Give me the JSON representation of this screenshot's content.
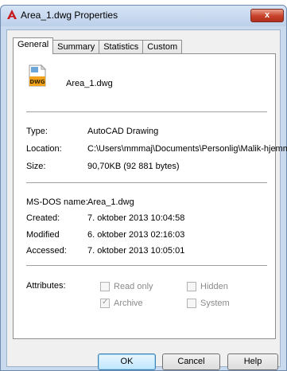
{
  "window": {
    "title": "Area_1.dwg Properties",
    "close_label": "x"
  },
  "tabs": [
    {
      "label": "General"
    },
    {
      "label": "Summary"
    },
    {
      "label": "Statistics"
    },
    {
      "label": "Custom"
    }
  ],
  "file": {
    "icon_text": "DWG",
    "name": "Area_1.dwg"
  },
  "info": {
    "type_label": "Type:",
    "type_value": "AutoCAD Drawing",
    "location_label": "Location:",
    "location_value": "C:\\Users\\mmmaj\\Documents\\Personlig\\Malik-hjemm",
    "size_label": "Size:",
    "size_value": "90,70KB (92 881 bytes)"
  },
  "dates": {
    "msdos_label": "MS-DOS name:",
    "msdos_value": "Area_1.dwg",
    "created_label": "Created:",
    "created_value": "7. oktober 2013  10:04:58",
    "modified_label": "Modified",
    "modified_value": "6. oktober 2013  02:16:03",
    "accessed_label": "Accessed:",
    "accessed_value": "7. oktober 2013  10:05:01"
  },
  "attributes": {
    "label": "Attributes:",
    "read_only": {
      "label": "Read only",
      "checked": false
    },
    "hidden": {
      "label": "Hidden",
      "checked": false
    },
    "archive": {
      "label": "Archive",
      "checked": true
    },
    "system": {
      "label": "System",
      "checked": false
    }
  },
  "buttons": {
    "ok": "OK",
    "cancel": "Cancel",
    "help": "Help"
  }
}
